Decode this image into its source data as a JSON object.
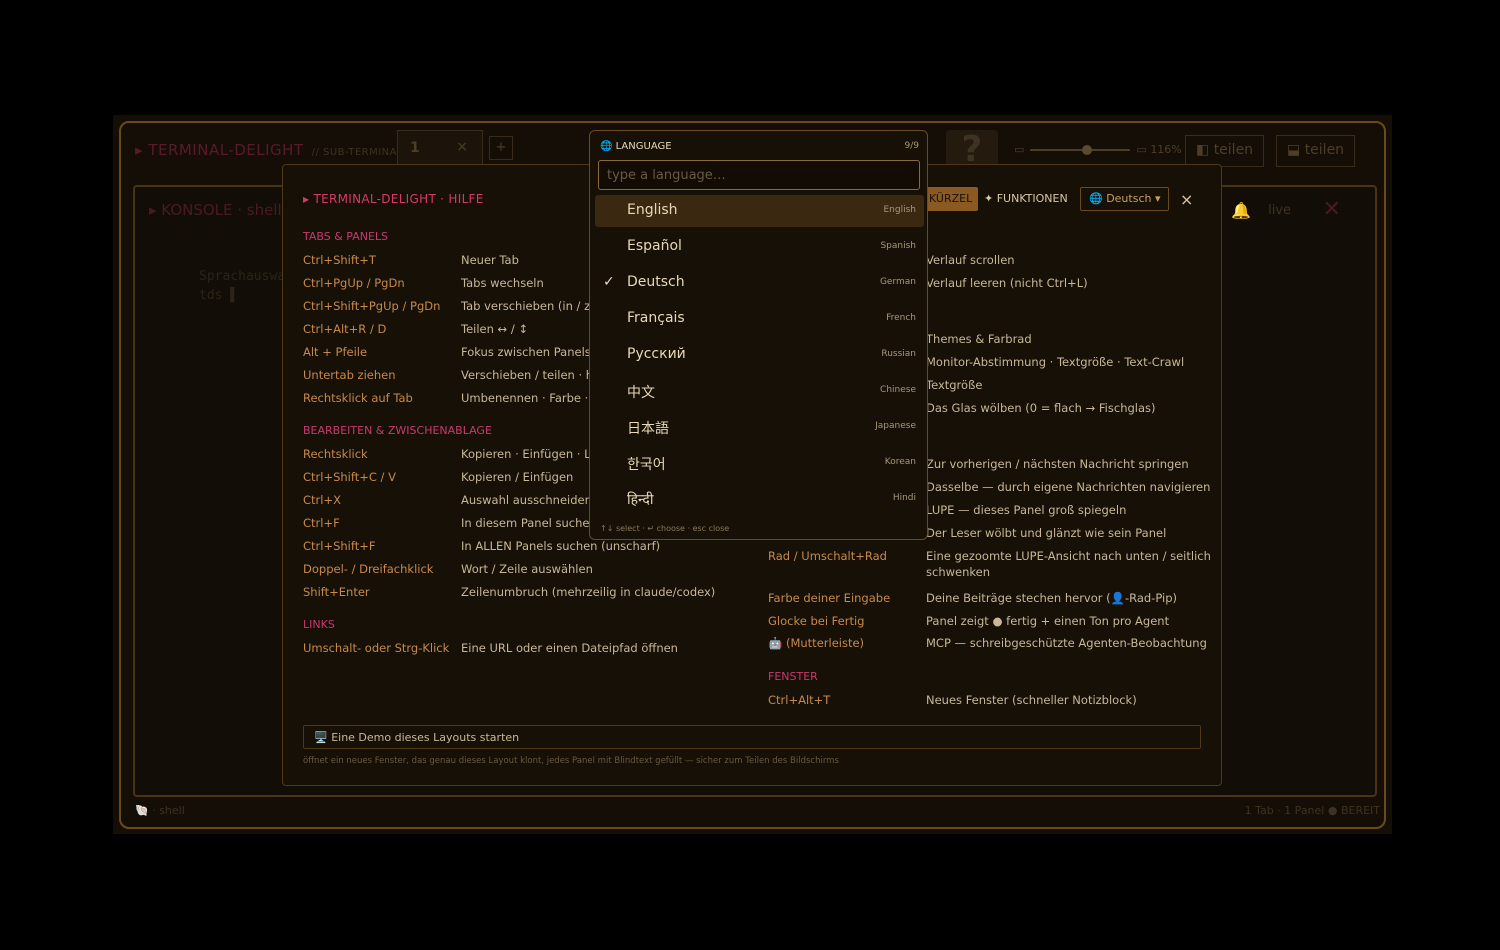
{
  "app": {
    "brand": "▸ TERMINAL-DELIGHT",
    "sub": "// SUB-TERMINAL",
    "tab_num": "1",
    "tab_close": "×",
    "plus": "+",
    "help": "?",
    "zoom": "116%",
    "split_v": "teilen",
    "split_h": "teilen"
  },
  "console": {
    "header": "▸ KONSOLE · shell",
    "bg1": "Sprachauswahl",
    "bg2": "tds ▌",
    "status_left": "· shell",
    "status_right": "1 Tab · 1 Panel  ● BEREIT",
    "icon_right": "live"
  },
  "help": {
    "title": "▸ TERMINAL-DELIGHT · HILFE",
    "tab_shortcuts": "KÜRZEL",
    "tab_functions": "✦ FUNKTIONEN",
    "lang_btn": "🌐 Deutsch ▾",
    "close": "×",
    "sec1": "TABS & PANELS",
    "left": [
      {
        "k": "Ctrl+Shift+T",
        "d": "Neuer Tab"
      },
      {
        "k": "Ctrl+PgUp / PgDn",
        "d": "Tabs wechseln"
      },
      {
        "k": "Ctrl+Shift+PgUp / PgDn",
        "d": "Tab verschieben (in / zwi"
      },
      {
        "k": "Ctrl+Alt+R / D",
        "d": "Teilen ↔ / ↕"
      },
      {
        "k": "Alt + Pfeile",
        "d": "Fokus zwischen Panels be"
      },
      {
        "k": "Untertab ziehen",
        "d": "Verschieben / teilen · her"
      },
      {
        "k": "Rechtsklick auf Tab",
        "d": "Umbenennen · Farbe · Gr"
      }
    ],
    "sec2": "BEARBEITEN & ZWISCHENABLAGE",
    "edit": [
      {
        "k": "Rechtsklick",
        "d": "Kopieren · Einfügen · Lin"
      },
      {
        "k": "Ctrl+Shift+C / V",
        "d": "Kopieren / Einfügen"
      },
      {
        "k": "Ctrl+X",
        "d": "Auswahl ausschneiden (l"
      },
      {
        "k": "Ctrl+F",
        "d": "In diesem Panel suchen ("
      },
      {
        "k": "Ctrl+Shift+F",
        "d": "In ALLEN Panels suchen (unscharf)"
      },
      {
        "k": "Doppel- / Dreifachklick",
        "d": "Wort / Zeile auswählen"
      },
      {
        "k": "Shift+Enter",
        "d": "Zeilenumbruch (mehrzeilig in claude/codex)"
      }
    ],
    "sec3": "LINKS",
    "links": [
      {
        "k": "Umschalt- oder Strg-Klick",
        "d": "Eine URL oder einen Dateipfad öffnen"
      }
    ],
    "right_desc": [
      "Verlauf scrollen",
      "Verlauf leeren (nicht Ctrl+L)",
      "Themes & Farbrad",
      "Monitor-Abstimmung · Textgröße · Text-Crawl",
      "Textgröße",
      "Das Glas wölben (0 = flach → Fischglas)",
      "Zur vorherigen / nächsten Nachricht springen",
      "Dasselbe — durch eigene Nachrichten navigieren",
      "LUPE — dieses Panel groß spiegeln",
      "Der Leser wölbt und glänzt wie sein Panel"
    ],
    "right_rows": [
      {
        "k": "Rad / Umschalt+Rad",
        "d": "Eine gezoomte LUPE-Ansicht nach unten / seitlich",
        "d2": "schwenken"
      },
      {
        "k": "Farbe deiner Eingabe",
        "d": "Deine Beiträge stechen hervor (👤-Rad-Pip)"
      },
      {
        "k": "Glocke bei Fertig",
        "d": "Panel zeigt ● fertig + einen Ton pro Agent"
      },
      {
        "k": "🤖 (Mutterleiste)",
        "d": "MCP — schreibgeschützte Agenten-Beobachtung"
      }
    ],
    "sec4": "FENSTER",
    "window": {
      "k": "Ctrl+Alt+T",
      "d": "Neues Fenster (schneller Notizblock)"
    },
    "demo": "🖥️  Eine Demo dieses Layouts starten",
    "demo_note": "öffnet ein neues Fenster, das genau dieses Layout klont, jedes Panel mit Blindtext gefüllt — sicher zum Teilen des Bildschirms"
  },
  "language": {
    "header": "🌐  LANGUAGE",
    "count": "9/9",
    "placeholder": "type a language…",
    "items": [
      {
        "n": "English",
        "e": "English",
        "sel": true
      },
      {
        "n": "Español",
        "e": "Spanish"
      },
      {
        "n": "Deutsch",
        "e": "German",
        "check": "✓"
      },
      {
        "n": "Français",
        "e": "French"
      },
      {
        "n": "Русский",
        "e": "Russian"
      },
      {
        "n": "中文",
        "e": "Chinese"
      },
      {
        "n": "日本語",
        "e": "Japanese"
      },
      {
        "n": "한국어",
        "e": "Korean"
      },
      {
        "n": "हिन्दी",
        "e": "Hindi"
      }
    ],
    "footer": "↑↓ select · ↵ choose · esc close"
  }
}
